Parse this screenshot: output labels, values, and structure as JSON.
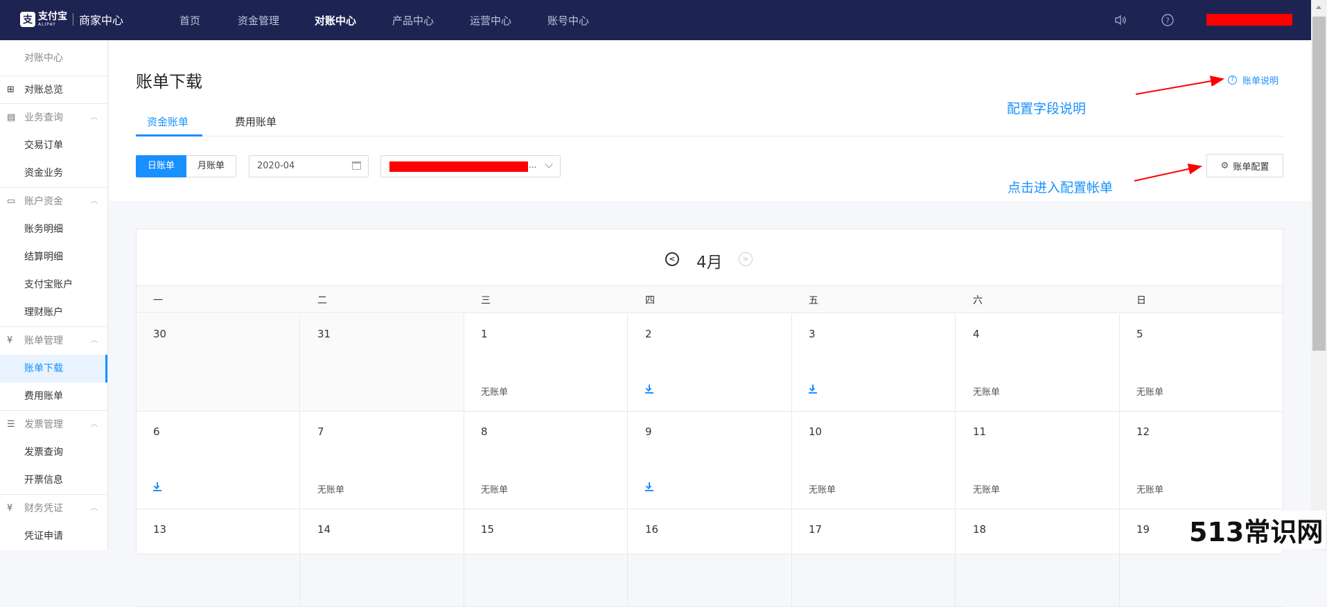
{
  "topnav": {
    "logo_cn": "支付宝",
    "logo_en": "ALIPAY",
    "logo_sub": "商家中心",
    "items": [
      "首页",
      "资金管理",
      "对账中心",
      "产品中心",
      "运营中心",
      "账号中心"
    ],
    "active": "对账中心"
  },
  "sidebar": {
    "title": "对账中心",
    "overview": "对账总览",
    "groups": [
      {
        "label": "业务查询",
        "items": [
          "交易订单",
          "资金业务"
        ]
      },
      {
        "label": "账户资金",
        "items": [
          "账务明细",
          "结算明细",
          "支付宝账户",
          "理财账户"
        ]
      },
      {
        "label": "账单管理",
        "items": [
          "账单下载",
          "费用账单"
        ]
      },
      {
        "label": "发票管理",
        "items": [
          "发票查询",
          "开票信息"
        ]
      },
      {
        "label": "财务凭证",
        "items": [
          "凭证申请"
        ]
      }
    ],
    "selected": "账单下载"
  },
  "page": {
    "title": "账单下载",
    "help_link": "账单说明",
    "tabs": [
      "资金账单",
      "费用账单"
    ],
    "active_tab": "资金账单",
    "segment": [
      "日账单",
      "月账单"
    ],
    "active_segment": "日账单",
    "date_value": "2020-04",
    "select_suffix": "...",
    "config_button": "账单配置"
  },
  "annotations": {
    "field_note": "配置字段说明",
    "config_note": "点击进入配置帐单",
    "color": "#1890ff",
    "arrow_color": "#ff0000"
  },
  "calendar": {
    "month": "4月",
    "weekdays": [
      "一",
      "二",
      "三",
      "四",
      "五",
      "六",
      "日"
    ],
    "weeks": [
      [
        {
          "day": "30",
          "status": "",
          "prev": true
        },
        {
          "day": "31",
          "status": "",
          "prev": true
        },
        {
          "day": "1",
          "status": "无账单"
        },
        {
          "day": "2",
          "status": "download"
        },
        {
          "day": "3",
          "status": "download"
        },
        {
          "day": "4",
          "status": "无账单"
        },
        {
          "day": "5",
          "status": "无账单"
        }
      ],
      [
        {
          "day": "6",
          "status": "download"
        },
        {
          "day": "7",
          "status": "无账单"
        },
        {
          "day": "8",
          "status": "无账单"
        },
        {
          "day": "9",
          "status": "download"
        },
        {
          "day": "10",
          "status": "无账单"
        },
        {
          "day": "11",
          "status": "无账单"
        },
        {
          "day": "12",
          "status": "无账单"
        }
      ],
      [
        {
          "day": "13",
          "status": ""
        },
        {
          "day": "14",
          "status": ""
        },
        {
          "day": "15",
          "status": ""
        },
        {
          "day": "16",
          "status": ""
        },
        {
          "day": "17",
          "status": ""
        },
        {
          "day": "18",
          "status": ""
        },
        {
          "day": "19",
          "status": ""
        }
      ]
    ]
  },
  "watermark": "513常识网"
}
